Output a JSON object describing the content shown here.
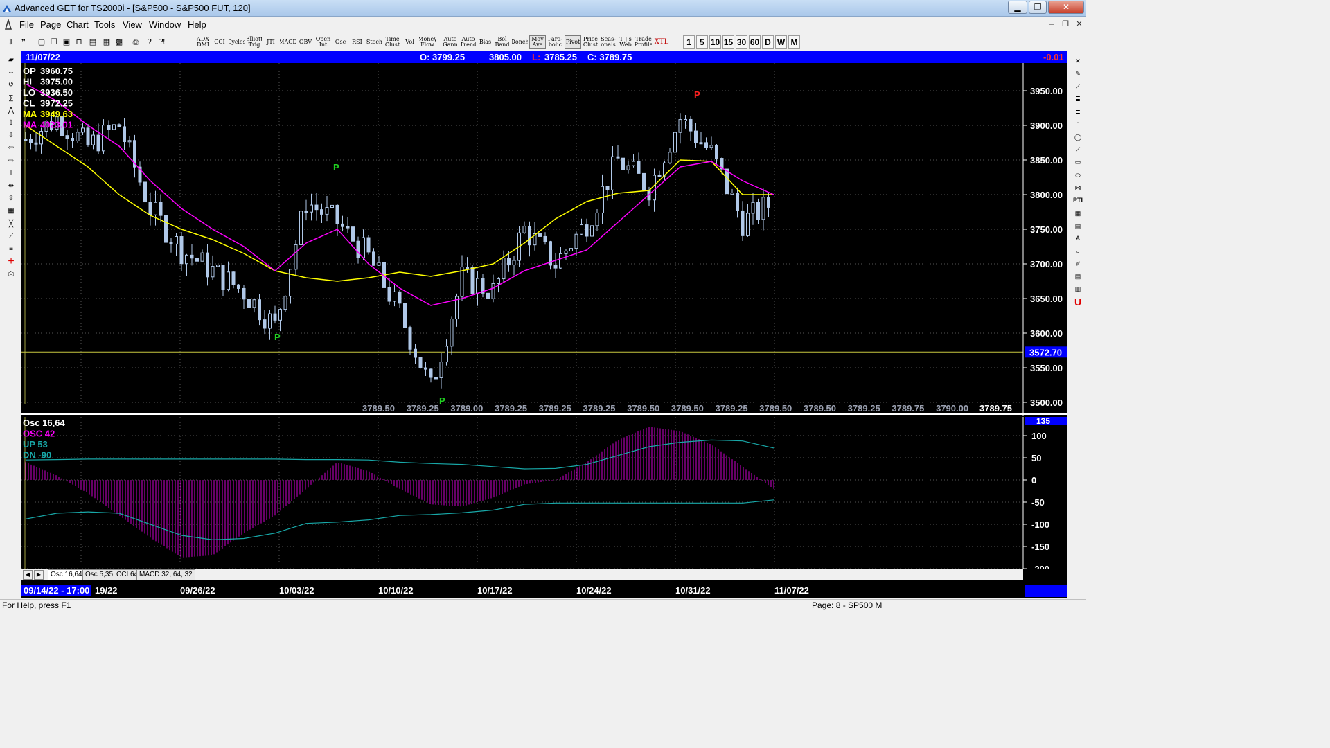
{
  "window": {
    "title": "Advanced GET for TS2000i - [S&P500 - S&P500 FUT, 120]",
    "minimize": "▁",
    "maximize": "❐",
    "close": "✕"
  },
  "menu": [
    "File",
    "Page",
    "Chart",
    "Tools",
    "View",
    "Window",
    "Help"
  ],
  "mdi_controls": [
    "–",
    "❐",
    "✕"
  ],
  "toolbar": {
    "studies": [
      "ADX\nDMI",
      "CCI",
      "Cycles",
      "Elliott\nTrig",
      "JTI",
      "MACD",
      "OBV",
      "Open\nInt",
      "Osc",
      "RSI",
      "Stoch",
      "Time\nClust",
      "Vol",
      "Money\nFlow",
      "Auto\nGann",
      "Auto\nTrend",
      "Bias",
      "Bol\nBand",
      "Donch",
      "Mov\nAve",
      "Para-\nbolic",
      "Pivot",
      "Price\nClust",
      "Seas-\nonals",
      "T J's\nWeb",
      "Trade\nProfile",
      "XTL"
    ],
    "timeframes": [
      "1",
      "5",
      "10",
      "15",
      "30",
      "60",
      "D",
      "W",
      "M"
    ]
  },
  "info_bar": {
    "date": "11/07/22",
    "open": "O: 3799.25",
    "high": "3805.00",
    "low_label": "L:",
    "low": "3785.25",
    "close": "C: 3789.75",
    "change": "-0.01"
  },
  "price_panel": {
    "stats": [
      {
        "label": "OP",
        "value": "3960.75",
        "color": "#ffffff"
      },
      {
        "label": "HI",
        "value": "3975.00",
        "color": "#ffffff"
      },
      {
        "label": "LO",
        "value": "3936.50",
        "color": "#ffffff"
      },
      {
        "label": "CL",
        "value": "3972.25",
        "color": "#ffffff"
      },
      {
        "label": "MA",
        "value": "3949.63",
        "color": "#ffff00"
      },
      {
        "label": "MA",
        "value": "4023.01",
        "color": "#ff00ff"
      }
    ],
    "axis_ticks": [
      "3950.00",
      "3900.00",
      "3850.00",
      "3800.00",
      "3750.00",
      "3700.00",
      "3650.00",
      "3600.00",
      "3550.00",
      "3500.00"
    ],
    "marker_line": "3572.70",
    "pivot_labels": [
      "P",
      "P",
      "P",
      "P"
    ],
    "tape": [
      "3789.50",
      "3789.25",
      "3789.00",
      "3789.25",
      "3789.25",
      "3789.25",
      "3789.50",
      "3789.50",
      "3789.25",
      "3789.50",
      "3789.50",
      "3789.25",
      "3789.75",
      "3790.00"
    ],
    "tape_last": "3789.75"
  },
  "osc_panel": {
    "legend": [
      {
        "text": "Osc 16,64",
        "color": "#ffffff"
      },
      {
        "text": "OSC 42",
        "color": "#ff00ff"
      },
      {
        "text": "UP   53",
        "color": "#18a8a8"
      },
      {
        "text": "DN   -90",
        "color": "#18a8a8"
      }
    ],
    "axis_top": "135",
    "axis_ticks": [
      "100",
      "50",
      "0",
      "-50",
      "-100",
      "-150",
      "-200"
    ],
    "tabs": [
      "Osc 16,64",
      "Osc 5,35",
      "CCI 64",
      "MACD 32, 64, 32"
    ]
  },
  "date_axis": {
    "current": "09/14/22 - 17:00",
    "labels": [
      "19/22",
      "09/26/22",
      "10/03/22",
      "10/10/22",
      "10/17/22",
      "10/24/22",
      "10/31/22",
      "11/07/22"
    ]
  },
  "status": {
    "help": "For Help, press F1",
    "page": "Page: 8 - SP500 M"
  },
  "colors": {
    "info_bar": "#0000ff",
    "bars": "#b0c8e8",
    "ma_fast": "#ffff00",
    "ma_slow": "#ff00ff",
    "osc": "#cc00cc",
    "bands": "#18a8a8",
    "pivot_high": "#ff2020",
    "pivot_low": "#20d020"
  },
  "chart_data": {
    "type": "line",
    "x": [
      "09/14/22",
      "09/16/22",
      "09/19/22",
      "09/21/22",
      "09/23/22",
      "09/26/22",
      "09/28/22",
      "09/30/22",
      "10/03/22",
      "10/05/22",
      "10/07/22",
      "10/10/22",
      "10/12/22",
      "10/13/22",
      "10/14/22",
      "10/17/22",
      "10/19/22",
      "10/21/22",
      "10/24/22",
      "10/26/22",
      "10/28/22",
      "10/31/22",
      "11/02/22",
      "11/04/22",
      "11/07/22"
    ],
    "price_range": [
      3490,
      3985
    ],
    "series": [
      {
        "values": [
          3880,
          3910,
          3870,
          3900,
          3780,
          3720,
          3690,
          3660,
          3610,
          3790,
          3760,
          3710,
          3630,
          3520,
          3680,
          3660,
          3750,
          3700,
          3760,
          3850,
          3810,
          3910,
          3860,
          3760,
          3790
        ]
      },
      {
        "values": [
          3900,
          3870,
          3840,
          3800,
          3770,
          3750,
          3735,
          3715,
          3690,
          3680,
          3675,
          3680,
          3688,
          3682,
          3690,
          3700,
          3730,
          3765,
          3790,
          3802,
          3806,
          3850,
          3848,
          3800,
          3800
        ]
      },
      {
        "values": [
          3960,
          3935,
          3900,
          3870,
          3820,
          3780,
          3750,
          3725,
          3690,
          3730,
          3750,
          3700,
          3665,
          3640,
          3650,
          3665,
          3690,
          3705,
          3720,
          3760,
          3800,
          3840,
          3848,
          3820,
          3800
        ]
      }
    ],
    "osc_range": [
      -210,
      140
    ],
    "osc_values": [
      40,
      10,
      -30,
      -80,
      -130,
      -175,
      -170,
      -120,
      -80,
      -20,
      40,
      20,
      -20,
      -55,
      -60,
      -40,
      -10,
      0,
      40,
      90,
      120,
      110,
      80,
      30,
      -20
    ],
    "up_band": [
      45,
      46,
      47,
      47,
      47,
      47,
      47,
      47,
      47,
      46,
      46,
      45,
      40,
      37,
      35,
      30,
      25,
      26,
      35,
      55,
      75,
      85,
      90,
      88,
      72
    ],
    "dn_band": [
      -88,
      -75,
      -72,
      -75,
      -100,
      -125,
      -135,
      -132,
      -120,
      -98,
      -95,
      -90,
      -80,
      -78,
      -74,
      -68,
      -55,
      -52,
      -52,
      -52,
      -52,
      -52,
      -52,
      -52,
      -45
    ],
    "xlabel": "",
    "ylabel": ""
  }
}
